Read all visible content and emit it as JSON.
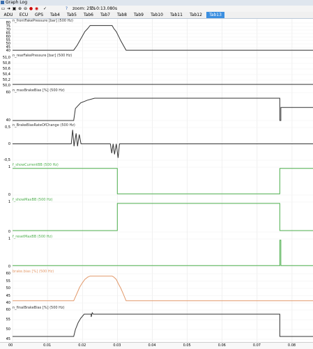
{
  "window": {
    "title": "Graph Log"
  },
  "toolbar": {
    "zoom_text": "zoom: 25%",
    "cursor_text": "C: 0:13.080s"
  },
  "tabs": [
    "ADU",
    "ECU",
    "GPS",
    "Tab4",
    "Tab5",
    "Tab6",
    "Tab7",
    "Tab8",
    "Tab9",
    "Tab10",
    "Tab11",
    "Tab12",
    "Tab13"
  ],
  "active_tab": "Tab13",
  "colors": {
    "black": "#333333",
    "green": "#4cae4c",
    "orange": "#e2996a"
  },
  "panes": [
    {
      "label": "n_frontFakePressure [bar] (500 Hz)",
      "yticks": [
        "80",
        "75",
        "70",
        "65",
        "60",
        "55",
        "50",
        "45",
        "40"
      ]
    },
    {
      "label": "n_rearFakePressure [bar] (500 Hz)",
      "yticks": [
        "51,0",
        "50,8",
        "50,6",
        "50,4",
        "50,2",
        "50,0"
      ]
    },
    {
      "label": "n_maxBrakeBias [%] (500 Hz)",
      "yticks": [
        "60",
        "40"
      ]
    },
    {
      "label": "n_BrakeBiasRateOfChange (500 Hz)",
      "yticks": [
        "0,5",
        "0",
        "-0,5"
      ]
    },
    {
      "label": "f_showCurrentBB (500 Hz)",
      "yticks": [
        "1",
        "0"
      ]
    },
    {
      "label": "f_showMaxBB (500 Hz)",
      "yticks": [
        "1",
        "0"
      ]
    },
    {
      "label": "f_resetMaxBB (500 Hz)",
      "yticks": [
        "1",
        "0"
      ]
    },
    {
      "label": "brake.bias [%] (500 Hz)",
      "yticks": [
        "60",
        "55",
        "50",
        "45",
        "40"
      ]
    },
    {
      "label": "n_finalBrakeBias [%] (500 Hz)",
      "yticks": [
        "60",
        "55",
        "50",
        "45"
      ]
    }
  ],
  "chart_data": {
    "type": "line",
    "xlabel": "",
    "xticks": [
      "00",
      "0.01",
      "0.02",
      "0.03",
      "0.04",
      "0.05",
      "0.06",
      "0.07",
      "0.08"
    ],
    "xlim": [
      0,
      0.086
    ],
    "series": [
      {
        "name": "n_frontFakePressure [bar] (500 Hz)",
        "ylim": [
          39,
          84
        ],
        "points": [
          [
            0,
            40
          ],
          [
            0.0175,
            40
          ],
          [
            0.0185,
            48
          ],
          [
            0.0192,
            55
          ],
          [
            0.02,
            63
          ],
          [
            0.0207,
            70
          ],
          [
            0.0215,
            75
          ],
          [
            0.0222,
            80
          ],
          [
            0.0285,
            80
          ],
          [
            0.029,
            75
          ],
          [
            0.0297,
            70
          ],
          [
            0.0303,
            63
          ],
          [
            0.031,
            55
          ],
          [
            0.0317,
            48
          ],
          [
            0.0325,
            40
          ],
          [
            0.086,
            40
          ]
        ]
      },
      {
        "name": "n_rearFakePressure [bar] (500 Hz)",
        "ylim": [
          49.95,
          51.0
        ],
        "points": [
          [
            0,
            50.0
          ],
          [
            0.086,
            50.0
          ]
        ]
      },
      {
        "name": "n_maxBrakeBias [%] (500 Hz)",
        "ylim": [
          38,
          68
        ],
        "points": [
          [
            0,
            38
          ],
          [
            0.0175,
            38
          ],
          [
            0.018,
            51
          ],
          [
            0.0195,
            57
          ],
          [
            0.0215,
            60
          ],
          [
            0.0235,
            62
          ],
          [
            0.0765,
            62
          ],
          [
            0.0765,
            38
          ],
          [
            0.0768,
            38
          ],
          [
            0.0768,
            52
          ],
          [
            0.086,
            52
          ]
        ]
      },
      {
        "name": "n_BrakeBiasRateOfChange (500 Hz)",
        "ylim": [
          -0.7,
          0.7
        ],
        "points": [
          [
            0,
            0
          ],
          [
            0.0168,
            0
          ],
          [
            0.0172,
            0.6
          ],
          [
            0.0176,
            -0.1
          ],
          [
            0.0182,
            0.45
          ],
          [
            0.0186,
            -0.1
          ],
          [
            0.0191,
            0.4
          ],
          [
            0.0196,
            0
          ],
          [
            0.028,
            0
          ],
          [
            0.0284,
            -0.4
          ],
          [
            0.0288,
            0
          ],
          [
            0.0292,
            -0.45
          ],
          [
            0.0297,
            0
          ],
          [
            0.0302,
            -0.6
          ],
          [
            0.0306,
            0
          ],
          [
            0.086,
            0
          ]
        ]
      },
      {
        "name": "f_showCurrentBB (500 Hz)",
        "ylim": [
          -0.05,
          1.05
        ],
        "points": [
          [
            0,
            1
          ],
          [
            0.03,
            1
          ],
          [
            0.03,
            0
          ],
          [
            0.0765,
            0
          ],
          [
            0.0765,
            1
          ],
          [
            0.086,
            1
          ]
        ]
      },
      {
        "name": "f_showMaxBB (500 Hz)",
        "ylim": [
          -0.05,
          1.05
        ],
        "points": [
          [
            0,
            0
          ],
          [
            0.03,
            0
          ],
          [
            0.03,
            1
          ],
          [
            0.0765,
            1
          ],
          [
            0.0765,
            0
          ],
          [
            0.086,
            0
          ]
        ]
      },
      {
        "name": "f_resetMaxBB (500 Hz)",
        "ylim": [
          -0.05,
          1.05
        ],
        "points": [
          [
            0,
            0
          ],
          [
            0.0765,
            0
          ],
          [
            0.0765,
            1
          ],
          [
            0.0768,
            1
          ],
          [
            0.0768,
            0
          ],
          [
            0.086,
            0
          ]
        ]
      },
      {
        "name": "brake.bias [%] (500 Hz)",
        "ylim": [
          38,
          64
        ],
        "points": [
          [
            0,
            40
          ],
          [
            0.0175,
            40
          ],
          [
            0.0185,
            47
          ],
          [
            0.0192,
            52
          ],
          [
            0.02,
            56
          ],
          [
            0.0207,
            59
          ],
          [
            0.0215,
            61
          ],
          [
            0.0222,
            62
          ],
          [
            0.0285,
            62
          ],
          [
            0.029,
            61
          ],
          [
            0.0297,
            59
          ],
          [
            0.0303,
            55
          ],
          [
            0.031,
            51
          ],
          [
            0.0317,
            46
          ],
          [
            0.0325,
            40
          ],
          [
            0.086,
            40
          ]
        ]
      },
      {
        "name": "n_finalBrakeBias [%] (500 Hz)",
        "ylim": [
          43,
          64
        ],
        "points": [
          [
            0,
            45
          ],
          [
            0.0175,
            45
          ],
          [
            0.018,
            50
          ],
          [
            0.0188,
            55
          ],
          [
            0.0195,
            58
          ],
          [
            0.0205,
            61
          ],
          [
            0.0225,
            61
          ],
          [
            0.0225,
            59
          ],
          [
            0.0228,
            62
          ],
          [
            0.0231,
            61
          ],
          [
            0.0765,
            61
          ],
          [
            0.0765,
            45
          ],
          [
            0.086,
            45
          ]
        ]
      }
    ]
  }
}
